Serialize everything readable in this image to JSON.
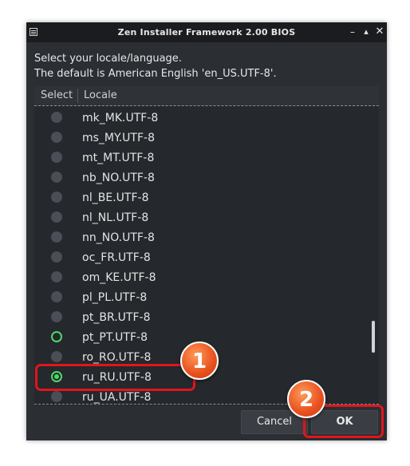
{
  "window": {
    "title": "Zen Installer Framework 2.00 BIOS",
    "controls": {
      "minimize": "–",
      "maximize": "▴",
      "close": "✕"
    }
  },
  "dialog": {
    "prompt_line1": "Select your locale/language.",
    "prompt_line2": "The default is American English 'en_US.UTF-8'."
  },
  "list": {
    "columns": [
      "Select",
      "Locale"
    ],
    "rows": [
      {
        "locale": "mk_MK.UTF-8",
        "state": "unselected"
      },
      {
        "locale": "ms_MY.UTF-8",
        "state": "unselected"
      },
      {
        "locale": "mt_MT.UTF-8",
        "state": "unselected"
      },
      {
        "locale": "nb_NO.UTF-8",
        "state": "unselected"
      },
      {
        "locale": "nl_BE.UTF-8",
        "state": "unselected"
      },
      {
        "locale": "nl_NL.UTF-8",
        "state": "unselected"
      },
      {
        "locale": "nn_NO.UTF-8",
        "state": "unselected"
      },
      {
        "locale": "oc_FR.UTF-8",
        "state": "unselected"
      },
      {
        "locale": "om_KE.UTF-8",
        "state": "unselected"
      },
      {
        "locale": "pl_PL.UTF-8",
        "state": "unselected"
      },
      {
        "locale": "pt_BR.UTF-8",
        "state": "unselected"
      },
      {
        "locale": "pt_PT.UTF-8",
        "state": "hover"
      },
      {
        "locale": "ro_RO.UTF-8",
        "state": "unselected"
      },
      {
        "locale": "ru_RU.UTF-8",
        "state": "checked"
      },
      {
        "locale": "ru_UA.UTF-8",
        "state": "unselected"
      }
    ]
  },
  "buttons": {
    "cancel": "Cancel",
    "ok": "OK"
  },
  "annotations": {
    "marker1": "1",
    "marker2": "2"
  },
  "colors": {
    "window_bg": "#2b2e33",
    "titlebar_bg": "#1a1c1f",
    "radio_accent": "#4cd964",
    "highlight": "#e0161b",
    "marker": "#e8501e"
  }
}
